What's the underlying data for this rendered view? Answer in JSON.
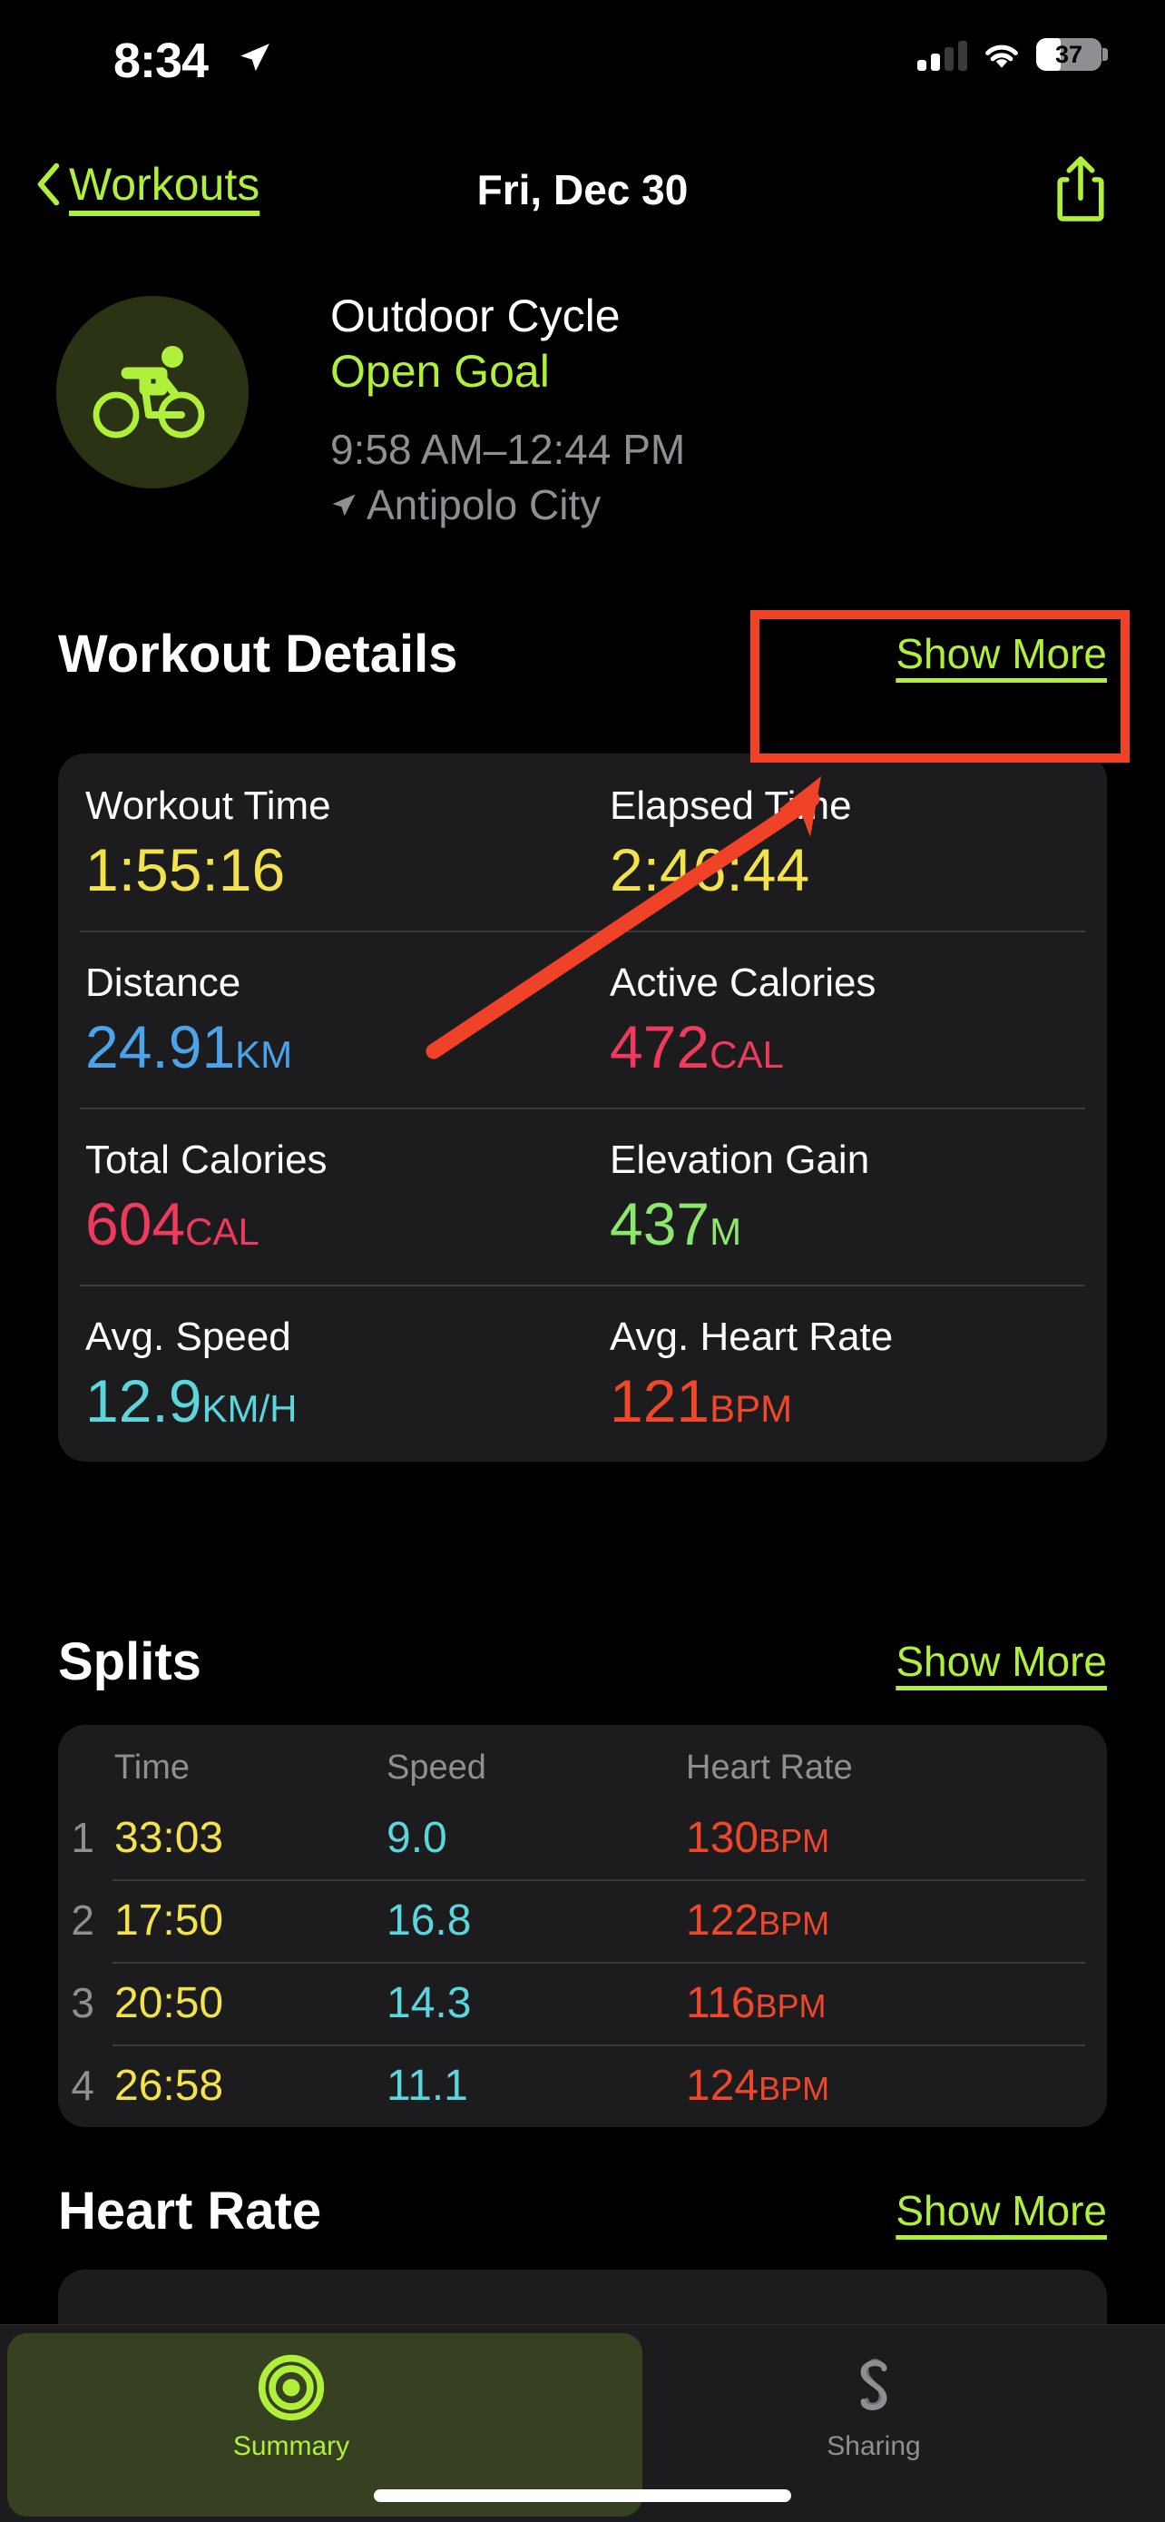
{
  "status_bar": {
    "time": "8:34",
    "location_icon": "location-arrow-icon",
    "cellular_bars_active": 2,
    "wifi_icon": "wifi-icon",
    "battery_percent": "37"
  },
  "nav_bar": {
    "back_label": "Workouts",
    "back_icon": "chevron-left-icon",
    "title": "Fri, Dec 30",
    "share_icon": "share-icon"
  },
  "workout_header": {
    "activity_icon": "cycling-icon",
    "title": "Outdoor Cycle",
    "goal": "Open Goal",
    "time_range": "9:58 AM–12:44 PM",
    "location_icon": "location-arrow-icon",
    "location": "Antipolo City"
  },
  "workout_details": {
    "section_title": "Workout Details",
    "show_more": "Show More",
    "metrics": [
      {
        "label": "Workout Time",
        "value": "1:55:16",
        "unit": "",
        "color": "#F2E24B"
      },
      {
        "label": "Elapsed Time",
        "value": "2:46:44",
        "unit": "",
        "color": "#F2E24B"
      },
      {
        "label": "Distance",
        "value": "24.91",
        "unit": "KM",
        "color": "#4BA3E8"
      },
      {
        "label": "Active Calories",
        "value": "472",
        "unit": "CAL",
        "color": "#EE3A5C"
      },
      {
        "label": "Total Calories",
        "value": "604",
        "unit": "CAL",
        "color": "#EE3A5C"
      },
      {
        "label": "Elevation Gain",
        "value": "437",
        "unit": "M",
        "color": "#8BE86B"
      },
      {
        "label": "Avg. Speed",
        "value": "12.9",
        "unit": "KM/H",
        "color": "#5AD7DD"
      },
      {
        "label": "Avg. Heart Rate",
        "value": "121",
        "unit": "BPM",
        "color": "#F0462A"
      }
    ]
  },
  "splits": {
    "section_title": "Splits",
    "show_more": "Show More",
    "columns": [
      "Time",
      "Speed",
      "Heart Rate"
    ],
    "rows": [
      {
        "index": "1",
        "time": "33:03",
        "speed": "9.0",
        "hr": "130",
        "hr_unit": "BPM"
      },
      {
        "index": "2",
        "time": "17:50",
        "speed": "16.8",
        "hr": "122",
        "hr_unit": "BPM"
      },
      {
        "index": "3",
        "time": "20:50",
        "speed": "14.3",
        "hr": "116",
        "hr_unit": "BPM"
      },
      {
        "index": "4",
        "time": "26:58",
        "speed": "11.1",
        "hr": "124",
        "hr_unit": "BPM"
      }
    ]
  },
  "heart_rate": {
    "section_title": "Heart Rate",
    "show_more": "Show More"
  },
  "tab_bar": {
    "tabs": [
      {
        "label": "Summary",
        "icon": "activity-rings-icon",
        "active": true
      },
      {
        "label": "Sharing",
        "icon": "sharing-icon",
        "active": false
      }
    ]
  },
  "annotation": {
    "highlight_target": "Show More",
    "box_color": "#F04226",
    "arrow_color": "#F04226"
  },
  "colors": {
    "accent_green": "#B1F03A",
    "card_bg": "#1C1C1E",
    "page_bg": "#000000",
    "secondary_text": "#8E8E93"
  }
}
